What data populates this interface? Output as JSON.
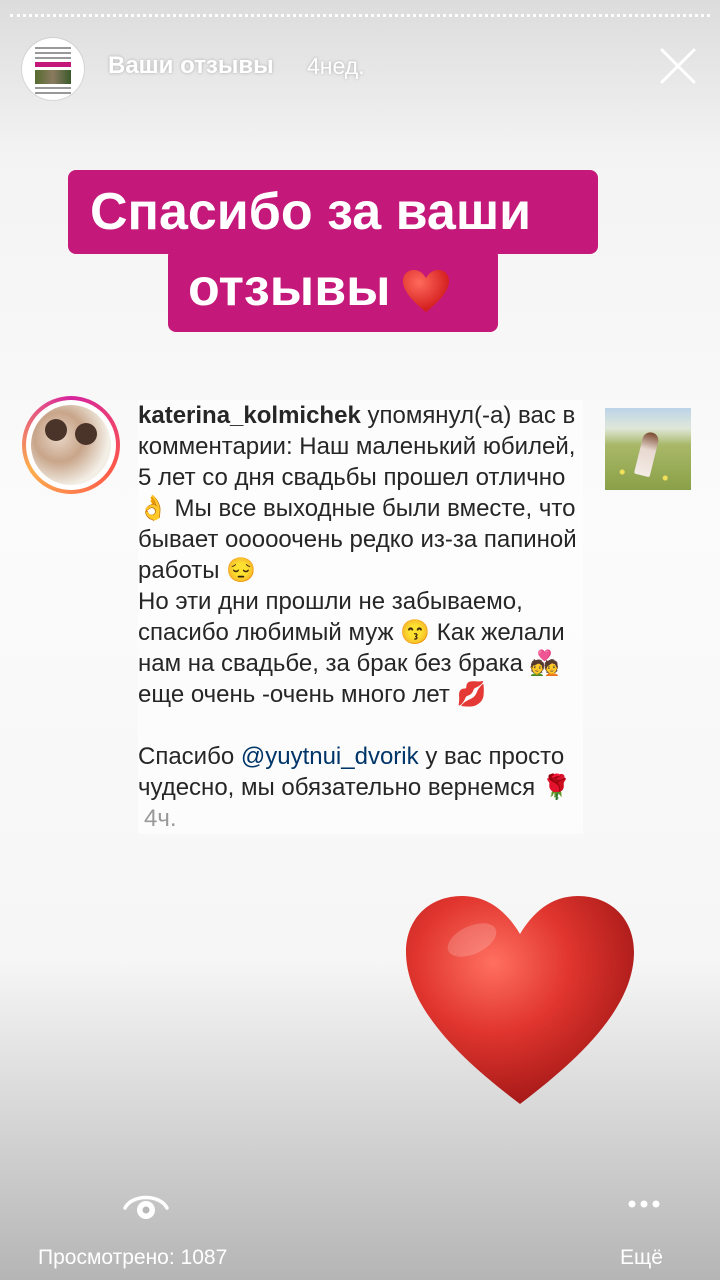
{
  "story": {
    "title": "Ваши отзывы",
    "time": "4нед."
  },
  "sticker": {
    "line1": "Спасибо за ваши",
    "line2": "отзывы",
    "emoji": "❤️"
  },
  "comment": {
    "username": "katerina_kolmichek",
    "lines_before_mention": [
      "упомянул(-а) вас в комментарии: Наш маленький юбилей, 5 лет со дня свадьбы прошел отлично 👌 Мы все выходные были вместе, что бывает ооооочень редко из-за папиной работы 😔",
      "Но эти дни прошли не забываемо, спасибо любимый муж 😙 Как желали нам на свадьбе, за брак без брака 💑 еще очень -очень много лет 💋"
    ],
    "thanks_prefix": "Спасибо",
    "mention": "@yuytnui_dvorik",
    "thanks_suffix": "у вас просто чудесно, мы обязательно вернемся 🌹",
    "time": "4ч."
  },
  "footer": {
    "seen_label": "Просмотрено: 1087",
    "more_label": "Ещё"
  },
  "icons": {
    "close": "close-icon",
    "seen": "eye-icon",
    "more": "more-dots-icon",
    "big_heart": "heart-sticker"
  },
  "colors": {
    "sticker_bg": "#c4197a",
    "mention": "#003569",
    "heart": "#d9302c"
  }
}
